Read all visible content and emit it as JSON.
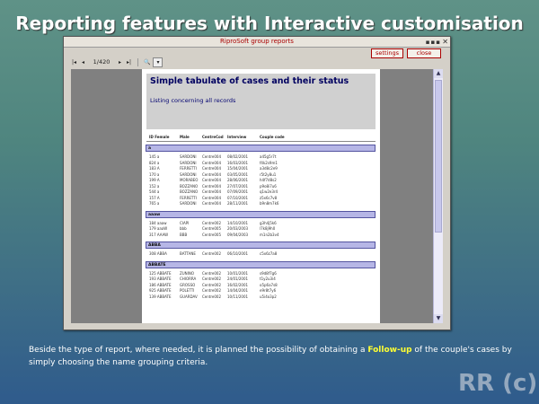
{
  "slide": {
    "title": "Reporting features with Interactive customisation",
    "caption_before": "Beside the type of report, where needed, it is planned the possibility of obtaining a ",
    "caption_highlight": "Follow-up",
    "caption_after": " of the couple's cases by simply choosing the name grouping criteria.",
    "watermark": "RR (c)"
  },
  "window": {
    "title": "RiproSoft group reports",
    "controls": "▪▪▪",
    "close_glyph": "✕",
    "settings_label": "settings",
    "close_label": "close"
  },
  "toolbar": {
    "first": "|◂",
    "prev": "◂",
    "page": "1/420",
    "next": "▸",
    "last": "▸|",
    "zoom": "🔍",
    "zoom_menu": "▾"
  },
  "report": {
    "title": "Simple tabulate of cases and their status",
    "subtitle": "Listing concerning all records",
    "columns": [
      "ID Female",
      "Male",
      "CentreCod",
      "Interview",
      "Couple code"
    ],
    "groups": [
      {
        "name": "a",
        "rows": [
          [
            "145 a",
            "SARDONI",
            "Centre004",
            "08/02/2001",
            "a45g5r7t"
          ],
          [
            "824 a",
            "SARDONI",
            "Centre004",
            "16/03/2001",
            "f4k2s9m1"
          ],
          [
            "183 A",
            "FERRETTI",
            "Centre004",
            "15/04/2001",
            "a3d8c2e9"
          ],
          [
            "170 a",
            "SARDONI",
            "Centre004",
            "03/05/2001",
            "r5t2y8u1"
          ],
          [
            "199 A",
            "MORABEO",
            "Centre004",
            "28/06/2001",
            "h4f7d8s2"
          ],
          [
            "152 a",
            "BOZZANO",
            "Centre004",
            "27/07/2001",
            "p9o8i7u6"
          ],
          [
            "544 a",
            "BOZZANO",
            "Centre004",
            "07/09/2001",
            "q1w2e3r4"
          ],
          [
            "157 A",
            "FERRETTI",
            "Centre004",
            "07/10/2001",
            "z5x6c7v8"
          ],
          [
            "765 a",
            "SARDONI",
            "Centre004",
            "28/11/2001",
            "b9n8m7k6"
          ]
        ]
      },
      {
        "name": "aaaw",
        "rows": [
          [
            "184 aaaw",
            "CIAPI",
            "Centre002",
            "14/10/2001",
            "g3h4j5k6"
          ],
          [
            "179 aaaW",
            "bbb",
            "Centre005",
            "20/03/2003",
            "l7k8j9h0"
          ],
          [
            "317 AAAW",
            "BBB",
            "Centre005",
            "09/04/2003",
            "m1n2b3v4"
          ]
        ]
      },
      {
        "name": "ABBA",
        "rows": [
          [
            "308 ABBA",
            "BATTANE",
            "Centre002",
            "06/10/2001",
            "c5x6z7a8"
          ]
        ]
      },
      {
        "name": "ABBATE",
        "rows": [
          [
            "125 ABBATE",
            "ZUNINO",
            "Centre002",
            "10/01/2001",
            "s9d8f7g6"
          ],
          [
            "193 ABBATE",
            "CHIORRA",
            "Centre002",
            "24/01/2001",
            "t1y2u3i4"
          ],
          [
            "186 ABBATE",
            "GROSSO",
            "Centre002",
            "16/02/2001",
            "o5p6a7s8"
          ],
          [
            "925 ABBATE",
            "POLETTI",
            "Centre002",
            "14/04/2001",
            "e9r8t7y6"
          ],
          [
            "139 ABBATE",
            "GUARDAV",
            "Centre002",
            "10/11/2001",
            "u5i4o3p2"
          ]
        ]
      }
    ]
  }
}
